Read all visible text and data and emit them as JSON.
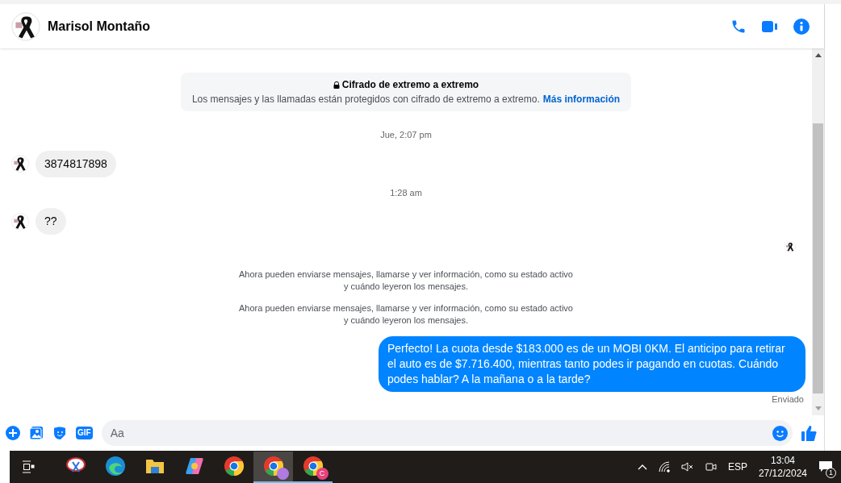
{
  "header": {
    "contact_name": "Marisol Montaño"
  },
  "chat": {
    "encryption": {
      "title": "Cifrado de extremo a extremo",
      "text": "Los mensajes y las llamadas están protegidos con cifrado de extremo a extremo.",
      "link": "Más información"
    },
    "items": [
      {
        "kind": "time",
        "text": "Jue, 2:07 pm"
      },
      {
        "kind": "incoming",
        "text": "3874817898"
      },
      {
        "kind": "time",
        "text": "1:28 am"
      },
      {
        "kind": "incoming",
        "text": "??"
      },
      {
        "kind": "seen"
      },
      {
        "kind": "info",
        "text": "Ahora pueden enviarse mensajes, llamarse y ver información, como su estado activo y cuándo leyeron los mensajes."
      },
      {
        "kind": "info",
        "text": "Ahora pueden enviarse mensajes, llamarse y ver información, como su estado activo y cuándo leyeron los mensajes."
      },
      {
        "kind": "outgoing",
        "text": "Perfecto! La cuota desde $183.000 es de un MOBI 0KM. El anticipo para retirar el auto es de $7.716.400, mientras tanto podes ir pagando en cuotas. Cuándo podes hablar? A la mañana o a la tarde?"
      },
      {
        "kind": "status",
        "text": "Enviado"
      }
    ]
  },
  "composer": {
    "placeholder": "Aa",
    "tools": [
      "GIF"
    ]
  },
  "taskbar": {
    "apps": [
      {
        "kind": "snip",
        "open": false,
        "selected": false
      },
      {
        "kind": "edge",
        "open": false,
        "selected": false
      },
      {
        "kind": "folder",
        "open": false,
        "selected": false
      },
      {
        "kind": "copilot",
        "open": false,
        "selected": false
      },
      {
        "kind": "chrome",
        "open": false,
        "selected": false
      },
      {
        "kind": "chrome-guest",
        "open": true,
        "selected": true
      },
      {
        "kind": "chrome-profile",
        "open": true,
        "selected": false,
        "badge": "C"
      }
    ],
    "language": "ESP",
    "time": "13:04",
    "date": "27/12/2024",
    "notifications": "1"
  }
}
